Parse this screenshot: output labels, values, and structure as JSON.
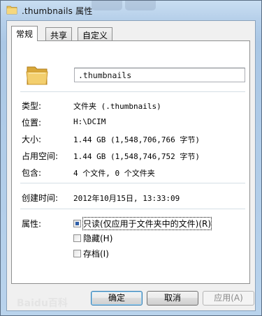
{
  "window": {
    "title": ".thumbnails 属性"
  },
  "tabs": [
    {
      "label": "常规",
      "active": true
    },
    {
      "label": "共享",
      "active": false
    },
    {
      "label": "自定义",
      "active": false
    }
  ],
  "general": {
    "name_value": ".thumbnails",
    "rows": {
      "type": {
        "label": "类型:",
        "value": "文件夹 (.thumbnails)"
      },
      "location": {
        "label": "位置:",
        "value": "H:\\DCIM"
      },
      "size": {
        "label": "大小:",
        "value": "1.44 GB (1,548,706,766 字节)"
      },
      "size_on_disk": {
        "label": "占用空间:",
        "value": "1.44 GB (1,548,746,752 字节)"
      },
      "contains": {
        "label": "包含:",
        "value": "4 个文件, 0 个文件夹"
      },
      "created": {
        "label": "创建时间:",
        "value": "2012年10月15日, 13:33:09"
      }
    },
    "attributes": {
      "label": "属性:",
      "readonly": "只读(仅应用于文件夹中的文件)(R)",
      "hidden": "隐藏(H)",
      "archive": "存档(I)"
    }
  },
  "buttons": {
    "ok": "确定",
    "cancel": "取消",
    "apply": "应用(A)"
  },
  "watermark": "Baidu百科",
  "colors": {
    "titlebar": "#b7d0ea",
    "default_button_border": "#3c7fb1",
    "checkbox_indeterminate": "#2f5fa8"
  }
}
